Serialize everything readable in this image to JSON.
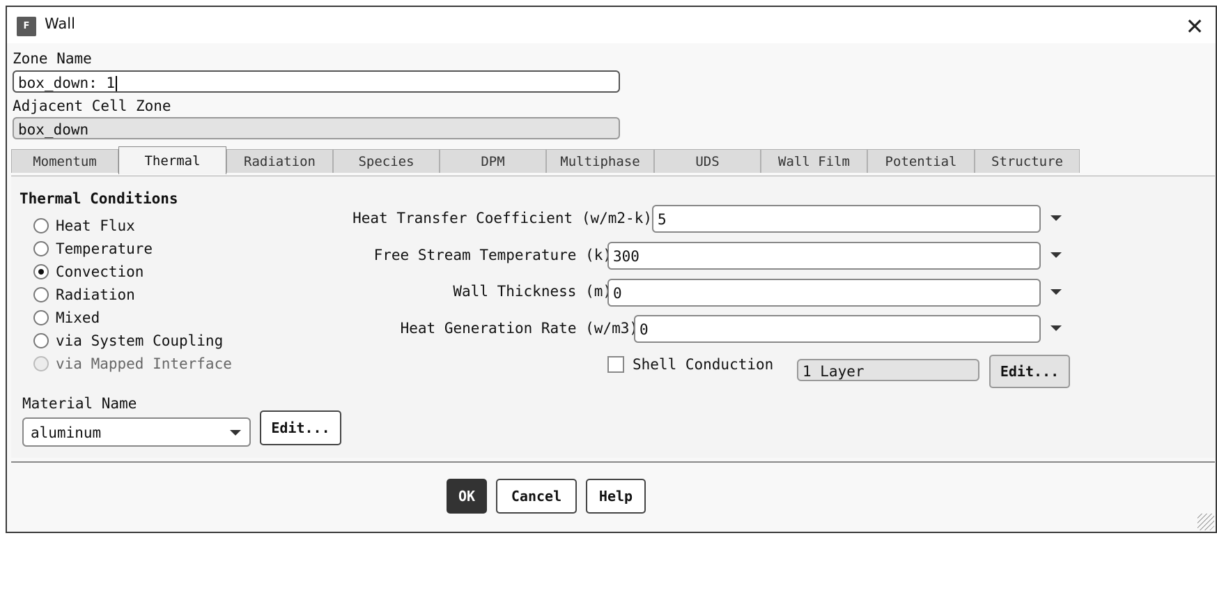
{
  "window": {
    "title": "Wall",
    "app_icon_letter": "F",
    "close_glyph": "✕"
  },
  "zone_name": {
    "label": "Zone Name",
    "value": "box_down: 1"
  },
  "adjacent_cell_zone": {
    "label": "Adjacent Cell Zone",
    "value": "box_down"
  },
  "tabs": [
    {
      "label": "Momentum"
    },
    {
      "label": "Thermal",
      "active": true
    },
    {
      "label": "Radiation"
    },
    {
      "label": "Species"
    },
    {
      "label": "DPM"
    },
    {
      "label": "Multiphase"
    },
    {
      "label": "UDS"
    },
    {
      "label": "Wall Film"
    },
    {
      "label": "Potential"
    },
    {
      "label": "Structure"
    }
  ],
  "thermal": {
    "section_title": "Thermal Conditions",
    "conditions": [
      {
        "label": "Heat Flux",
        "checked": false
      },
      {
        "label": "Temperature",
        "checked": false
      },
      {
        "label": "Convection",
        "checked": true
      },
      {
        "label": "Radiation",
        "checked": false
      },
      {
        "label": "Mixed",
        "checked": false
      },
      {
        "label": "via System Coupling",
        "checked": false
      },
      {
        "label": "via Mapped Interface",
        "checked": false,
        "disabled": true
      }
    ],
    "properties": [
      {
        "label": "Heat Transfer Coefficient",
        "unit": "(w/m2-k)",
        "value": "5"
      },
      {
        "label": "Free Stream Temperature",
        "unit": "(k)",
        "value": "300"
      },
      {
        "label": "Wall Thickness",
        "unit": "(m)",
        "value": "0"
      },
      {
        "label": "Heat Generation Rate",
        "unit": "(w/m3)",
        "value": "0"
      }
    ],
    "shell_conduction": {
      "label": "Shell Conduction",
      "checked": false,
      "layers": "1 Layer",
      "edit_label": "Edit..."
    },
    "material": {
      "label": "Material Name",
      "value": "aluminum",
      "edit_label": "Edit..."
    }
  },
  "footer": {
    "ok": "OK",
    "cancel": "Cancel",
    "help": "Help"
  }
}
